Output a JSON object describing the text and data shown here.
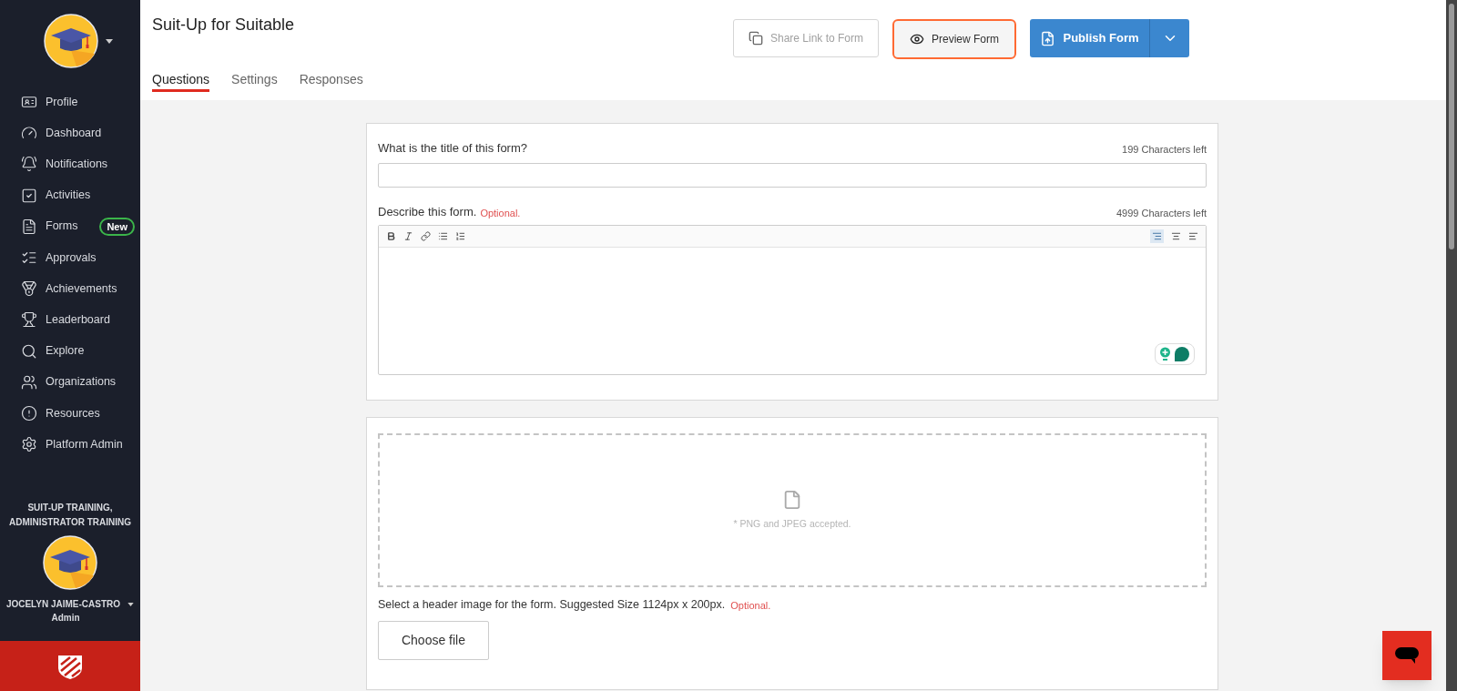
{
  "sidebar": {
    "items": [
      {
        "kind": "profile",
        "label": "Profile"
      },
      {
        "kind": "dashboard",
        "label": "Dashboard"
      },
      {
        "kind": "notifications",
        "label": "Notifications"
      },
      {
        "kind": "activities",
        "label": "Activities"
      },
      {
        "kind": "forms",
        "label": "Forms",
        "badge": "New"
      },
      {
        "kind": "approvals",
        "label": "Approvals"
      },
      {
        "kind": "achievements",
        "label": "Achievements"
      },
      {
        "kind": "leaderboard",
        "label": "Leaderboard"
      },
      {
        "kind": "explore",
        "label": "Explore"
      },
      {
        "kind": "organizations",
        "label": "Organizations"
      },
      {
        "kind": "resources",
        "label": "Resources"
      },
      {
        "kind": "admin",
        "label": "Platform Admin"
      }
    ],
    "organization": "SUIT-UP TRAINING, ADMINISTRATOR TRAINING",
    "user_name": "JOCELYN JAIME-CASTRO",
    "user_role": "Admin"
  },
  "header": {
    "title": "Suit-Up for Suitable",
    "buttons": [
      {
        "kind": "share",
        "label": "Share Link to Form"
      },
      {
        "kind": "preview",
        "label": "Preview Form"
      },
      {
        "kind": "publish",
        "label": "Publish Form"
      }
    ]
  },
  "tabs": [
    {
      "label": "Questions",
      "selected": true
    },
    {
      "label": "Settings",
      "selected": false
    },
    {
      "label": "Responses",
      "selected": false
    }
  ],
  "form": {
    "title_label": "What is the title of this form?",
    "title_counter": "199 Characters left",
    "description_label": "Describe this form.",
    "description_optional": "Optional.",
    "description_counter": "4999 Characters left",
    "image_hint": "* PNG and JPEG accepted.",
    "image_label": "Select a header image for the form. Suggested Size 1124px x 200px.",
    "image_optional": "Optional.",
    "choose_file": "Choose file"
  }
}
